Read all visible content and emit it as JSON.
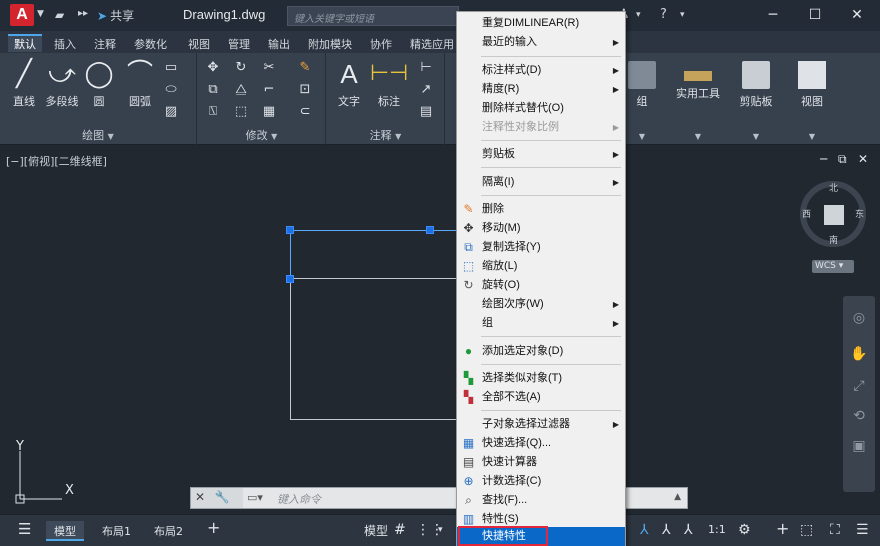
{
  "titlebar": {
    "logo": "A",
    "share": "共享",
    "document": "Drawing1.dwg",
    "search_placeholder": "键入关键字或短语"
  },
  "ribbon_tabs": [
    "默认",
    "插入",
    "注释",
    "参数化",
    "视图",
    "管理",
    "输出",
    "附加模块",
    "协作",
    "精选应用"
  ],
  "panels": {
    "draw": {
      "title": "绘图",
      "tools": [
        "直线",
        "多段线",
        "圆",
        "圆弧"
      ]
    },
    "modify": {
      "title": "修改"
    },
    "annotation": {
      "title": "注释",
      "tools": [
        "文字",
        "标注"
      ]
    },
    "right": [
      "组",
      "实用工具",
      "剪贴板",
      "视图"
    ]
  },
  "viewport": {
    "label": "[−][俯视][二维线框]",
    "compass": {
      "n": "北",
      "s": "南",
      "e": "东",
      "w": "西"
    },
    "wcs": "WCS"
  },
  "ucs": {
    "x": "X",
    "y": "Y"
  },
  "commandline": {
    "placeholder": "键入命令"
  },
  "statusbar": {
    "tabs": [
      "模型",
      "布局1",
      "布局2"
    ],
    "model_button": "模型",
    "scale": "1:1"
  },
  "context_menu": {
    "items": [
      {
        "label": "重复DIMLINEAR(R)",
        "icon": "",
        "sub": false
      },
      {
        "label": "最近的输入",
        "icon": "",
        "sub": true
      },
      {
        "label": "标注样式(D)",
        "icon": "",
        "sub": true
      },
      {
        "label": "精度(R)",
        "icon": "",
        "sub": true
      },
      {
        "label": "删除样式替代(O)",
        "icon": "",
        "sub": false
      },
      {
        "label": "注释性对象比例",
        "icon": "",
        "sub": true,
        "disabled": true
      },
      {
        "label": "剪贴板",
        "icon": "",
        "sub": true
      },
      {
        "label": "隔离(I)",
        "icon": "",
        "sub": true
      },
      {
        "label": "删除",
        "icon": "eraser-icon",
        "sub": false
      },
      {
        "label": "移动(M)",
        "icon": "move-icon",
        "sub": false
      },
      {
        "label": "复制选择(Y)",
        "icon": "copy-icon",
        "sub": false
      },
      {
        "label": "缩放(L)",
        "icon": "scale-icon",
        "sub": false
      },
      {
        "label": "旋转(O)",
        "icon": "rotate-icon",
        "sub": false
      },
      {
        "label": "绘图次序(W)",
        "icon": "",
        "sub": true
      },
      {
        "label": "组",
        "icon": "",
        "sub": true
      },
      {
        "label": "添加选定对象(D)",
        "icon": "add-selected-icon",
        "sub": false
      },
      {
        "label": "选择类似对象(T)",
        "icon": "select-similar-icon",
        "sub": false
      },
      {
        "label": "全部不选(A)",
        "icon": "deselect-all-icon",
        "sub": false
      },
      {
        "label": "子对象选择过滤器",
        "icon": "",
        "sub": true
      },
      {
        "label": "快速选择(Q)...",
        "icon": "quick-select-icon",
        "sub": false
      },
      {
        "label": "快速计算器",
        "icon": "calculator-icon",
        "sub": false
      },
      {
        "label": "计数选择(C)",
        "icon": "count-icon",
        "sub": false
      },
      {
        "label": "查找(F)...",
        "icon": "find-icon",
        "sub": false
      },
      {
        "label": "特性(S)",
        "icon": "properties-icon",
        "sub": false
      },
      {
        "label": "快捷特性",
        "icon": "",
        "sub": false,
        "highlighted": true
      }
    ]
  },
  "colors": {
    "accent": "#0a68c8",
    "highlight_border": "#e0283a",
    "brand": "#d4252f"
  }
}
